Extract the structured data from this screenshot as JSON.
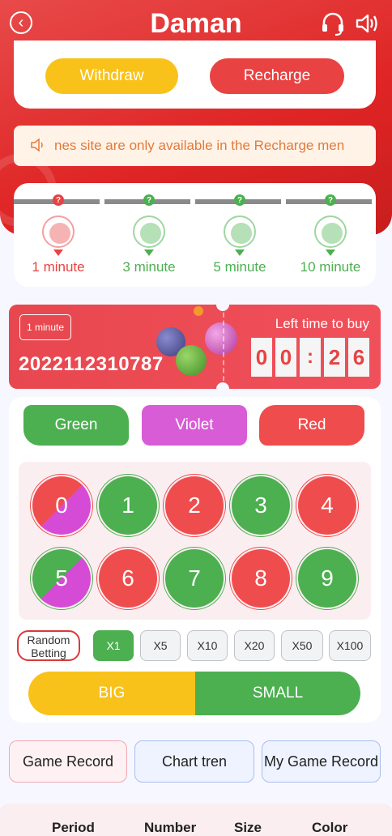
{
  "header": {
    "brand": "Daman",
    "back_icon": "chevron-left-icon",
    "support_icon": "headset-icon",
    "sound_icon": "speaker-icon"
  },
  "wallet": {
    "withdraw_label": "Withdraw",
    "recharge_label": "Recharge"
  },
  "notice": {
    "icon": "speaker-icon",
    "text": "nes site are only available in the Recharge men"
  },
  "timer_tabs": [
    {
      "label": "1 minute",
      "color": "#e84242"
    },
    {
      "label": "3 minute",
      "color": "#4caf50"
    },
    {
      "label": "5 minute",
      "color": "#4caf50"
    },
    {
      "label": "10 minute",
      "color": "#4caf50"
    }
  ],
  "round": {
    "tag": "1 minute",
    "period": "2022112310787",
    "left_time_label": "Left time to buy",
    "countdown": [
      "0",
      "0",
      ":",
      "2",
      "6"
    ]
  },
  "colors": {
    "green_label": "Green",
    "violet_label": "Violet",
    "red_label": "Red"
  },
  "numbers": [
    {
      "n": "0",
      "color": "red-violet"
    },
    {
      "n": "1",
      "color": "green"
    },
    {
      "n": "2",
      "color": "red"
    },
    {
      "n": "3",
      "color": "green"
    },
    {
      "n": "4",
      "color": "red"
    },
    {
      "n": "5",
      "color": "green-violet"
    },
    {
      "n": "6",
      "color": "red"
    },
    {
      "n": "7",
      "color": "green"
    },
    {
      "n": "8",
      "color": "red"
    },
    {
      "n": "9",
      "color": "green"
    }
  ],
  "betting": {
    "random_label": "Random Betting",
    "multipliers": [
      "X1",
      "X5",
      "X10",
      "X20",
      "X50",
      "X100"
    ],
    "active_multiplier": "X1",
    "big_label": "BIG",
    "small_label": "SMALL"
  },
  "records": {
    "game_record": "Game Record",
    "chart_trend": "Chart tren",
    "my_game_record": "My Game Record"
  },
  "table": {
    "headers": [
      "Period",
      "Number",
      "Size",
      "Color"
    ]
  },
  "accent_colors": {
    "red": "#e84242",
    "green": "#4caf50",
    "violet": "#d85cd6",
    "yellow": "#f8c21a"
  }
}
